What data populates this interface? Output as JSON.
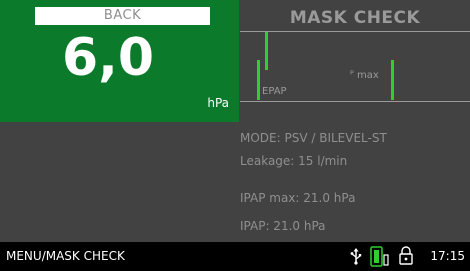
{
  "back_button": "BACK",
  "pressure": {
    "value": "6,0",
    "unit": "hPa"
  },
  "mask_check": {
    "title": "MASK CHECK",
    "epap_label": "EPAP",
    "p_max_label": "ᴾ max"
  },
  "info": {
    "mode": "MODE: PSV / BILEVEL-ST",
    "leakage": "Leakage: 15 l/min",
    "ipap_max": "IPAP max: 21.0 hPa",
    "ipap": "IPAP: 21.0 hPa"
  },
  "status_bar": {
    "menu_path": "MENU/MASK CHECK",
    "time": "17:15",
    "icons": [
      "usb-icon",
      "battery-icon",
      "lock-icon"
    ]
  },
  "colors": {
    "pressure_panel": "#0b7a2a",
    "indicator_green": "#2fcf2f",
    "background": "#424242"
  }
}
